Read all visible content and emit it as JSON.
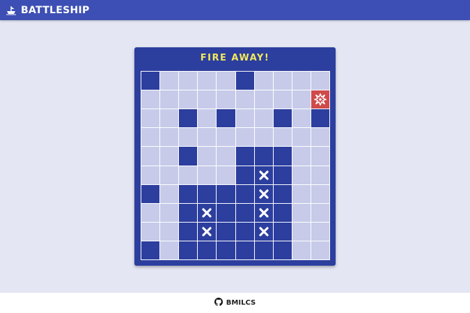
{
  "header": {
    "title": "BATTLESHIP",
    "logo_icon": "ship-wheel-icon"
  },
  "board": {
    "title": "FIRE AWAY!",
    "colors": {
      "water": "#c7cbe9",
      "ship": "#2c3e9e",
      "hit": "#cf4a4a",
      "miss_mark": "#ffffff"
    },
    "rows": [
      [
        "ship",
        "water",
        "water",
        "water",
        "water",
        "ship",
        "water",
        "water",
        "water",
        "water"
      ],
      [
        "water",
        "water",
        "water",
        "water",
        "water",
        "water",
        "water",
        "water",
        "water",
        "hit"
      ],
      [
        "water",
        "water",
        "ship",
        "water",
        "ship",
        "water",
        "water",
        "ship",
        "water",
        "ship"
      ],
      [
        "water",
        "water",
        "water",
        "water",
        "water",
        "water",
        "water",
        "water",
        "water",
        "water"
      ],
      [
        "water",
        "water",
        "ship",
        "water",
        "water",
        "ship",
        "ship",
        "ship",
        "water",
        "water"
      ],
      [
        "water",
        "water",
        "water",
        "water",
        "water",
        "ship",
        "miss",
        "ship",
        "water",
        "water"
      ],
      [
        "ship",
        "water",
        "ship",
        "ship",
        "ship",
        "ship",
        "miss",
        "ship",
        "water",
        "water"
      ],
      [
        "water",
        "water",
        "ship",
        "miss",
        "ship",
        "ship",
        "miss",
        "ship",
        "water",
        "water"
      ],
      [
        "water",
        "water",
        "ship",
        "miss",
        "ship",
        "ship",
        "miss",
        "ship",
        "water",
        "water"
      ],
      [
        "ship",
        "water",
        "ship",
        "ship",
        "ship",
        "ship",
        "ship",
        "ship",
        "water",
        "water"
      ]
    ]
  },
  "footer": {
    "link_label": "BMILCS",
    "icon": "github-icon"
  }
}
